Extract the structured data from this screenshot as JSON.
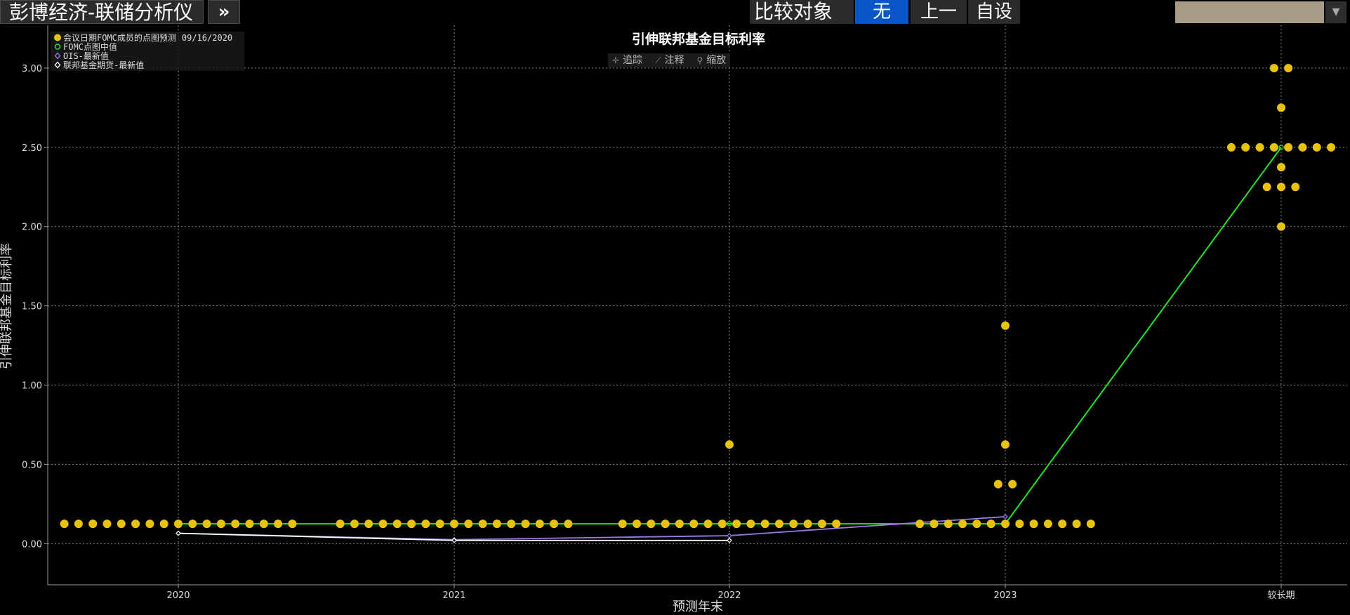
{
  "header": {
    "title": "彭博经济-联储分析仪",
    "more_label": "»",
    "compare_label": "比较对象",
    "btn_none": "无",
    "btn_prev": "上一",
    "btn_custom": "自设"
  },
  "toolbar": {
    "track_label": "追踪",
    "annotate_label": "注释",
    "zoom_label": "缩放"
  },
  "legend": {
    "dots_label": "会议日期FOMC成员的点图预测",
    "dots_date": "09/16/2020",
    "median_label": "FOMC点图中值",
    "ois_label": "OIS-最新值",
    "futures_label": "联邦基金期货-最新值"
  },
  "colors": {
    "dots": "#e8c20e",
    "median": "#22e422",
    "ois": "#9b7be8",
    "futures": "#ffffff",
    "grid": "#8a8a8a"
  },
  "chart_data": {
    "type": "scatter",
    "title": "引伸联邦基金目标利率",
    "xlabel": "预测年末",
    "ylabel": "引伸联邦基金目标利率",
    "categories": [
      "2020",
      "2021",
      "2022",
      "2023",
      "较长期"
    ],
    "y_ticks": [
      "0.00",
      "0.50",
      "1.00",
      "1.50",
      "2.00",
      "2.50",
      "3.00"
    ],
    "ylim": [
      -0.26,
      3.27
    ],
    "grid": true,
    "legend_position": "top-left",
    "dot_plot": [
      {
        "category": "2020",
        "rates": [
          {
            "rate": 0.125,
            "count": 17
          }
        ]
      },
      {
        "category": "2021",
        "rates": [
          {
            "rate": 0.125,
            "count": 17
          }
        ]
      },
      {
        "category": "2022",
        "rates": [
          {
            "rate": 0.625,
            "count": 1
          },
          {
            "rate": 0.125,
            "count": 16
          }
        ]
      },
      {
        "category": "2023",
        "rates": [
          {
            "rate": 1.375,
            "count": 1
          },
          {
            "rate": 0.625,
            "count": 1
          },
          {
            "rate": 0.375,
            "count": 2
          },
          {
            "rate": 0.125,
            "count": 13
          }
        ]
      },
      {
        "category": "较长期",
        "rates": [
          {
            "rate": 3.0,
            "count": 2
          },
          {
            "rate": 2.75,
            "count": 1
          },
          {
            "rate": 2.5,
            "count": 8
          },
          {
            "rate": 2.375,
            "count": 1
          },
          {
            "rate": 2.25,
            "count": 3
          },
          {
            "rate": 2.0,
            "count": 1
          }
        ]
      }
    ],
    "series": [
      {
        "name": "FOMC点图中值",
        "values": [
          0.125,
          0.125,
          0.125,
          0.125,
          2.5
        ]
      },
      {
        "name": "OIS-最新值",
        "values": [
          0.065,
          0.025,
          0.05,
          0.17,
          null
        ]
      },
      {
        "name": "联邦基金期货-最新值",
        "values": [
          0.065,
          0.02,
          0.02,
          null,
          null
        ]
      }
    ]
  }
}
